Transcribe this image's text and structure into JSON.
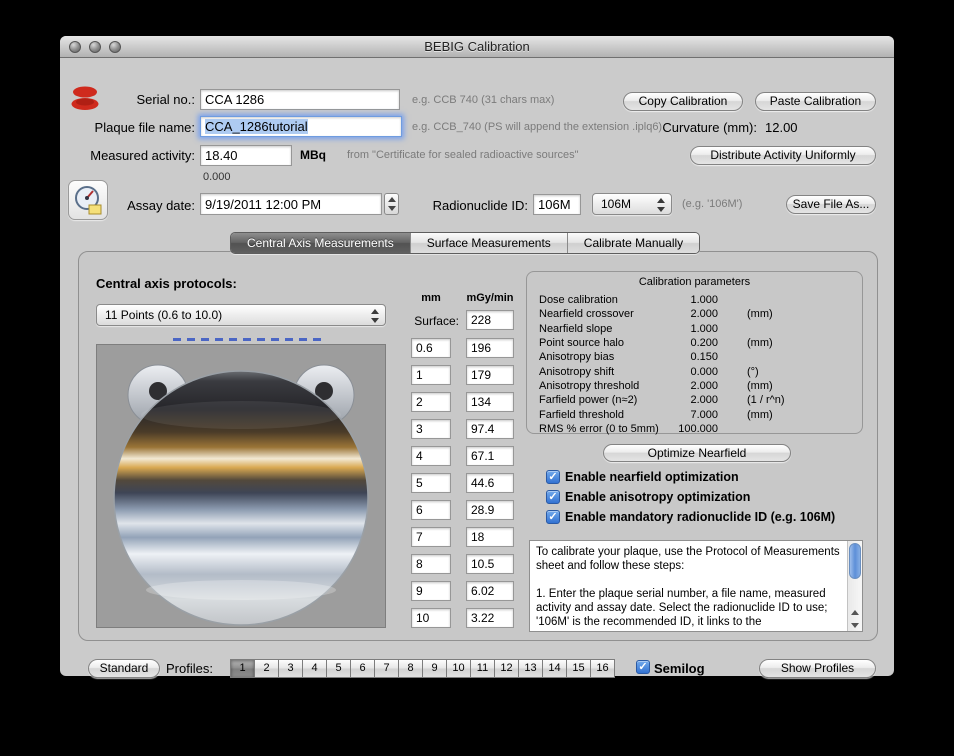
{
  "window": {
    "title": "BEBIG Calibration"
  },
  "header": {
    "serial_label": "Serial no.:",
    "serial_value": "CCA 1286",
    "serial_hint": "e.g. CCB 740 (31 chars max)",
    "copy_button": "Copy Calibration",
    "paste_button": "Paste Calibration",
    "filename_label": "Plaque file name:",
    "filename_value": "CCA_1286tutorial",
    "filename_hint": "e.g. CCB_740 (PS will append the extension .iplq6)",
    "curvature_label": "Curvature (mm):",
    "curvature_value": "12.00",
    "activity_label": "Measured activity:",
    "activity_value": "18.40",
    "activity_unit": "MBq",
    "activity_hint": "from \"Certificate for sealed radioactive sources\"",
    "distribute_button": "Distribute Activity Uniformly",
    "activity_secondary": "0.000",
    "assay_label": "Assay date:",
    "assay_value": "9/19/2011 12:00 PM",
    "radionuclide_label": "Radionuclide ID:",
    "radionuclide_value": "106M",
    "radionuclide_select": "106M",
    "radionuclide_hint": "(e.g. '106M')",
    "save_button": "Save File As..."
  },
  "tabs": {
    "central": "Central Axis Measurements",
    "surface": "Surface Measurements",
    "manual": "Calibrate Manually"
  },
  "protocols": {
    "label": "Central axis protocols:",
    "selected": "11 Points (0.6 to 10.0)"
  },
  "measurements": {
    "col_mm": "mm",
    "col_dose": "mGy/min",
    "surface_label": "Surface:",
    "surface_value": "228",
    "rows": [
      {
        "mm": "0.6",
        "dose": "196"
      },
      {
        "mm": "1",
        "dose": "179"
      },
      {
        "mm": "2",
        "dose": "134"
      },
      {
        "mm": "3",
        "dose": "97.4"
      },
      {
        "mm": "4",
        "dose": "67.1"
      },
      {
        "mm": "5",
        "dose": "44.6"
      },
      {
        "mm": "6",
        "dose": "28.9"
      },
      {
        "mm": "7",
        "dose": "18"
      },
      {
        "mm": "8",
        "dose": "10.5"
      },
      {
        "mm": "9",
        "dose": "6.02"
      },
      {
        "mm": "10",
        "dose": "3.22"
      }
    ]
  },
  "calibration": {
    "title": "Calibration parameters",
    "params": [
      {
        "name": "Dose calibration",
        "value": "1.000",
        "unit": ""
      },
      {
        "name": "Nearfield crossover",
        "value": "2.000",
        "unit": "(mm)"
      },
      {
        "name": "Nearfield slope",
        "value": "1.000",
        "unit": ""
      },
      {
        "name": "Point source halo",
        "value": "0.200",
        "unit": "(mm)"
      },
      {
        "name": "Anisotropy bias",
        "value": "0.150",
        "unit": ""
      },
      {
        "name": "Anisotropy shift",
        "value": "0.000",
        "unit": "(°)"
      },
      {
        "name": "Anisotropy threshold",
        "value": "2.000",
        "unit": "(mm)"
      },
      {
        "name": "Farfield power (n≈2)",
        "value": "2.000",
        "unit": "(1 / r^n)"
      },
      {
        "name": "Farfield threshold",
        "value": "7.000",
        "unit": "(mm)"
      },
      {
        "name": "RMS  % error (0 to 5mm)",
        "value": "100.000",
        "unit": ""
      }
    ],
    "optimize_button": "Optimize Nearfield",
    "checks": [
      "Enable nearfield optimization",
      "Enable anisotropy optimization",
      "Enable mandatory radionuclide ID (e.g. 106M)"
    ]
  },
  "instructions": "To calibrate your plaque, use the Protocol of Measurements sheet and follow these steps:\n\n1. Enter the plaque serial number, a file name, measured activity and assay date. Select the radionuclide ID to use; '106M' is the recommended ID, it links to the",
  "footer": {
    "standard": "Standard",
    "profiles_label": "Profiles:",
    "profiles": [
      "1",
      "2",
      "3",
      "4",
      "5",
      "6",
      "7",
      "8",
      "9",
      "10",
      "11",
      "12",
      "13",
      "14",
      "15",
      "16"
    ],
    "semilog": "Semilog",
    "show_profiles": "Show Profiles"
  }
}
